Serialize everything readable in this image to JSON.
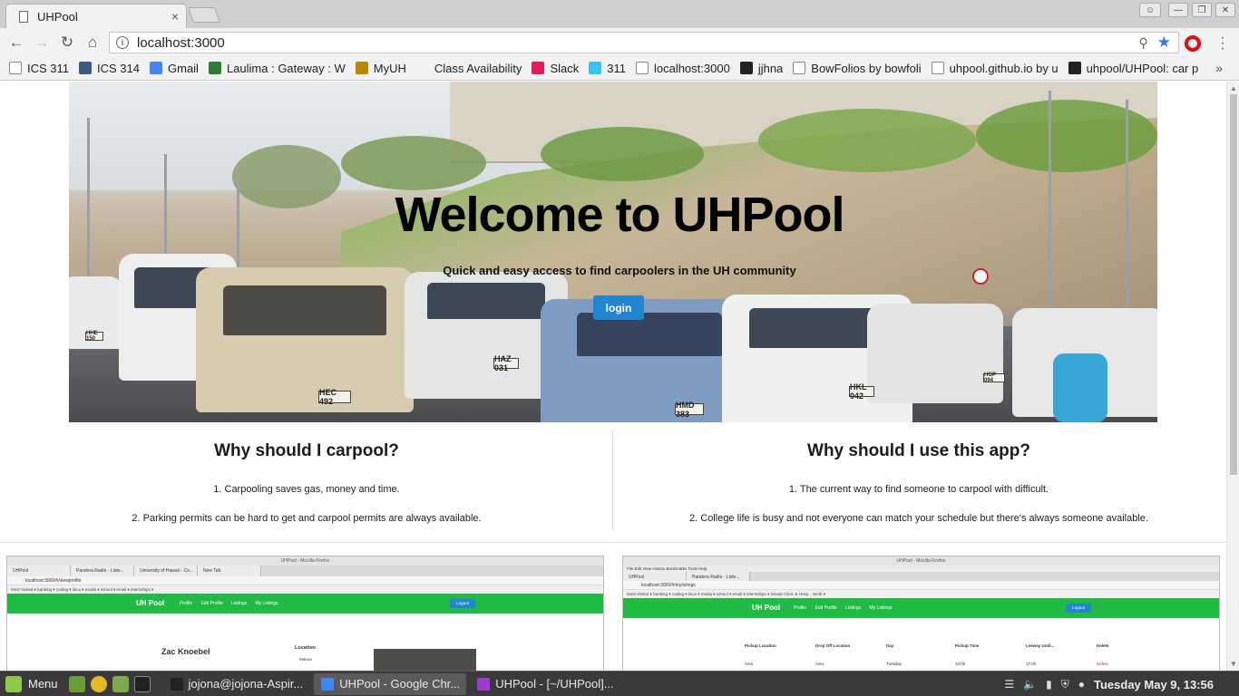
{
  "browser": {
    "tab_title": "UHPool",
    "tab_close": "×",
    "url": "localhost:3000",
    "info_icon": "i",
    "zoom_icon": "⚲",
    "star_icon": "★",
    "bookmarks": [
      {
        "label": "ICS 311",
        "icon": "doc-icon",
        "color": "#888888"
      },
      {
        "label": "ICS 314",
        "icon": "square-icon",
        "color": "#3d5a80"
      },
      {
        "label": "Gmail",
        "icon": "google-icon",
        "color": "#4285f4"
      },
      {
        "label": "Laulima : Gateway : W",
        "icon": "leaf-icon",
        "color": "#2e7d32"
      },
      {
        "label": "MyUH",
        "icon": "uh-icon",
        "color": "#b8860b"
      },
      {
        "label": "Class Availability",
        "icon": "blank-icon",
        "color": "#f2f2f2"
      },
      {
        "label": "Slack",
        "icon": "slack-icon",
        "color": "#e01e5a"
      },
      {
        "label": "311",
        "icon": "slack-icon",
        "color": "#36c5f0"
      },
      {
        "label": "localhost:3000",
        "icon": "doc-icon",
        "color": "#888888"
      },
      {
        "label": "jjhna",
        "icon": "github-icon",
        "color": "#222222"
      },
      {
        "label": "BowFolios by bowfoli",
        "icon": "doc-icon",
        "color": "#888888"
      },
      {
        "label": "uhpool.github.io by u",
        "icon": "doc-icon",
        "color": "#888888"
      },
      {
        "label": "uhpool/UHPool: car p",
        "icon": "github-icon",
        "color": "#222222"
      }
    ],
    "bookmarks_more": "»"
  },
  "hero": {
    "title": "Welcome to UHPool",
    "subtitle": "Quick and easy access to find carpoolers in the UH community",
    "login_label": "login",
    "plates": [
      "HEC 492",
      "HAZ 031",
      "HMD 383",
      "HKL 042",
      "HHE 150",
      "HGP 094"
    ]
  },
  "why_carpool": {
    "heading": "Why should I carpool?",
    "points": [
      "1. Carpooling saves gas, money and time.",
      "2. Parking permits can be hard to get and carpool permits are always available."
    ]
  },
  "why_app": {
    "heading": "Why should I use this app?",
    "points": [
      "1. The current way to find someone to carpool with difficult.",
      "2. College life is busy and not everyone can match your schedule but there's always someone available."
    ]
  },
  "screenshots": [
    {
      "window_title": "UHPool - Mozilla Firefox",
      "tabs": [
        "UHPool",
        "Pandora Radio - Liste...",
        "University of Hawaii - Co...",
        "New Tab"
      ],
      "address": "localhost:3000/#/viewprofile",
      "bookmarks": "Most Visited ▾   banking ▾   coding ▾   linux ▾   media ▾   school ▾   email ▾   internships ▾",
      "brand": "UH Pool",
      "nav": [
        "Profile",
        "Edit Profile",
        "Listings",
        "My Listings"
      ],
      "logout": "Logout",
      "profile_name": "Zac Knoebel",
      "location_label": "Location",
      "location_value": "Manoa"
    },
    {
      "window_title": "UHPool - Mozilla Firefox",
      "menu": "File  Edit  View  History  Bookmarks  Tools  Help",
      "tabs": [
        "UHPool",
        "Pandora Radio - Liste..."
      ],
      "address": "localhost:3000/#/mylistings",
      "bookmarks": "Most Visited ▾   banking ▾   coding ▾   linux ▾   media ▾   school ▾   email ▾   internships ▾   Straub Clinic & Hosp...   Work ▾",
      "brand": "UH Pool",
      "nav": [
        "Profile",
        "Edit Profile",
        "Listings",
        "My Listings"
      ],
      "logout": "Logout",
      "table_headers": [
        "Pickup Location",
        "Drop Off Location",
        "Day",
        "Pickup Time",
        "Leeway Until...",
        "Delete"
      ],
      "row": [
        "Aiea",
        "Aiea",
        "Tuesday",
        "10:00",
        "17:00",
        "Delete"
      ]
    }
  ],
  "taskbar": {
    "menu_label": "Menu",
    "tasks": [
      {
        "label": "jojona@jojona-Aspir...",
        "icon": "terminal-icon",
        "color": "#222222"
      },
      {
        "label": "UHPool - Google Chr...",
        "icon": "chrome-icon",
        "color": "#4285f4"
      },
      {
        "label": "UHPool - [~/UHPool]...",
        "icon": "webstorm-icon",
        "color": "#a03bd1"
      }
    ],
    "clock": "Tuesday May 9, 13:56"
  }
}
